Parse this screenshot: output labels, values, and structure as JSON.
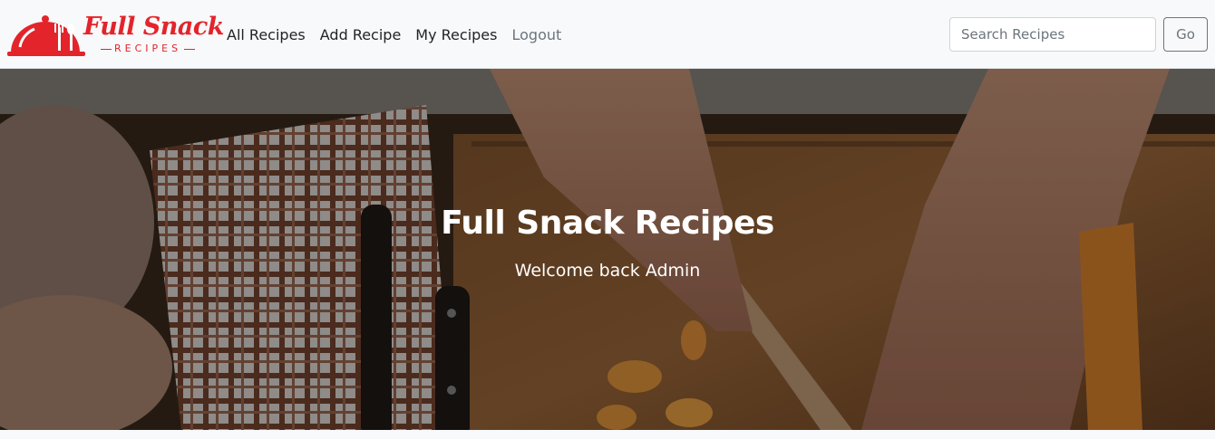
{
  "brand": {
    "title": "Full Snack",
    "subtitle": "RECIPES",
    "icon": "cloche-cutlery-icon",
    "color": "#e3242b"
  },
  "nav": {
    "items": [
      {
        "label": "All Recipes"
      },
      {
        "label": "Add Recipe"
      },
      {
        "label": "My Recipes"
      },
      {
        "label": "Logout"
      }
    ]
  },
  "search": {
    "placeholder": "Search Recipes",
    "value": "",
    "button_label": "Go"
  },
  "hero": {
    "title": "Full Snack Recipes",
    "subtitle": "Welcome back Admin",
    "image": "cutting-board-background"
  }
}
